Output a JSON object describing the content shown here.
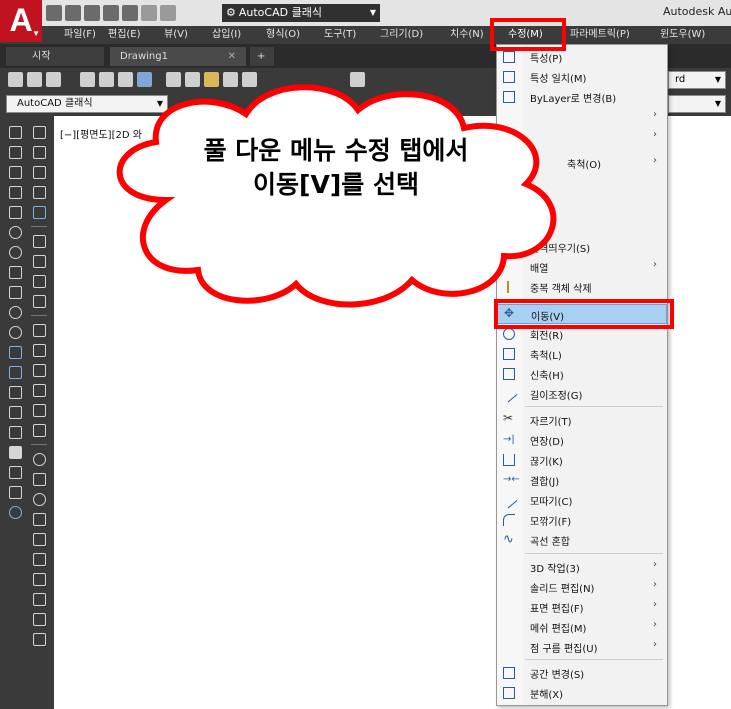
{
  "title": "Autodesk Aut",
  "logo_letter": "A",
  "workspace": {
    "name": "AutoCAD 클래식"
  },
  "menubar": {
    "items": [
      {
        "label": "파일(F)"
      },
      {
        "label": "편집(E)"
      },
      {
        "label": "뷰(V)"
      },
      {
        "label": "삽입(I)"
      },
      {
        "label": "형식(O)"
      },
      {
        "label": "도구(T)"
      },
      {
        "label": "그리기(D)"
      },
      {
        "label": "치수(N)"
      },
      {
        "label": "수정(M)"
      },
      {
        "label": "파라메트릭(P)"
      },
      {
        "label": "윈도우(W)"
      }
    ]
  },
  "tabs": {
    "start": "시작",
    "drawing": "Drawing1",
    "close": "✕",
    "new": "+"
  },
  "toolbar2": {
    "workspace_combo": "AutoCAD 클래식",
    "right_combo": "rd"
  },
  "viewport_label": "[−][평면도][2D 와",
  "dropdown": {
    "items": [
      {
        "label": "특성(P)"
      },
      {
        "label": "특성 일치(M)"
      },
      {
        "label": "ByLayer로 변경(B)"
      },
      {
        "label": "",
        "submenu": true
      },
      {
        "label": "",
        "submenu": true
      },
      {
        "label": "축척(O)",
        "submenu": true
      },
      {
        "label": "간격띄우기(S)"
      },
      {
        "label": "배열",
        "submenu": true
      },
      {
        "label": "중복 객체 삭제"
      },
      {
        "label": "이동(V)",
        "selected": true
      },
      {
        "label": "회전(R)"
      },
      {
        "label": "축척(L)"
      },
      {
        "label": "신축(H)"
      },
      {
        "label": "길이조정(G)"
      },
      {
        "label": "자르기(T)"
      },
      {
        "label": "연장(D)"
      },
      {
        "label": "끊기(K)"
      },
      {
        "label": "결합(J)"
      },
      {
        "label": "모따기(C)"
      },
      {
        "label": "모깎기(F)"
      },
      {
        "label": "곡선 혼합"
      },
      {
        "label": "3D 작업(3)",
        "submenu": true
      },
      {
        "label": "솔리드 편집(N)",
        "submenu": true
      },
      {
        "label": "표면 편집(F)",
        "submenu": true
      },
      {
        "label": "메쉬 편집(M)",
        "submenu": true
      },
      {
        "label": "점 구름 편집(U)",
        "submenu": true
      },
      {
        "label": "공간 변경(S)"
      },
      {
        "label": "분해(X)"
      }
    ],
    "submenu_arrow": "›"
  },
  "callout": {
    "line1": "풀 다운 메뉴 수정 탭에서",
    "line2": "이동[V]를 선택"
  },
  "colors": {
    "highlight": "#ff0000",
    "menubar": "#3b3b3b",
    "selection": "#a9cff2",
    "logo": "#c1121f"
  }
}
